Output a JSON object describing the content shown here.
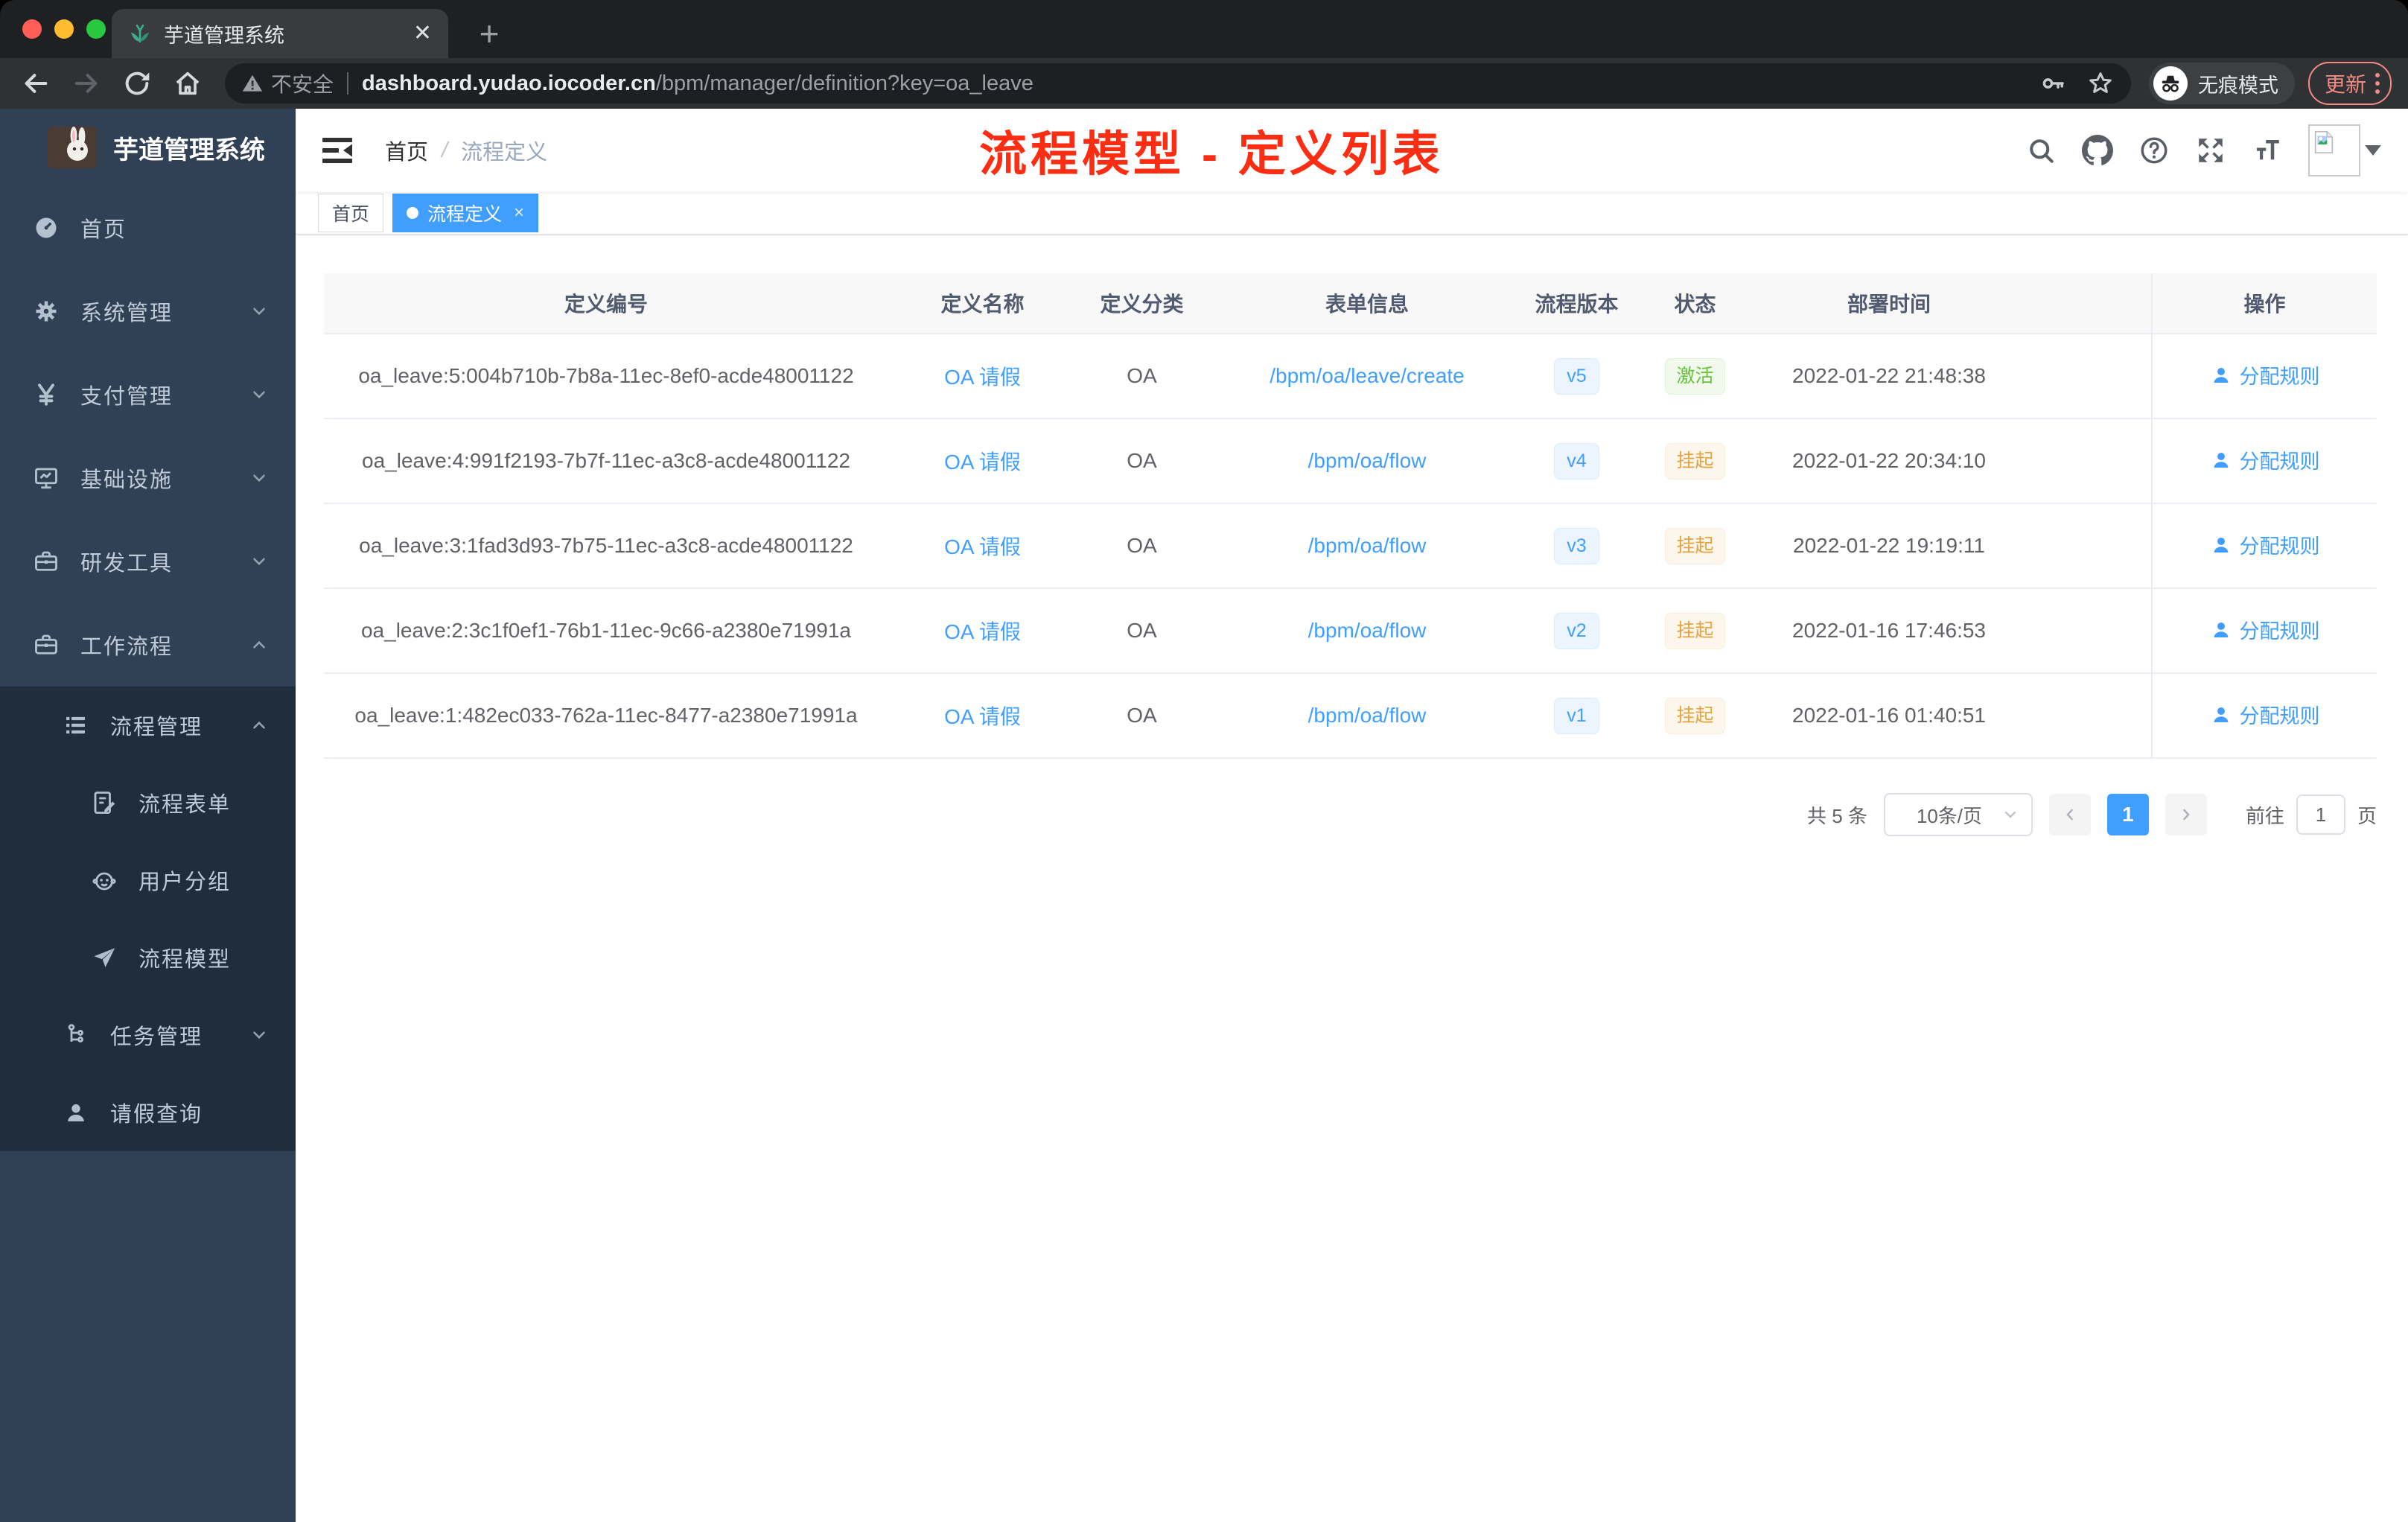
{
  "browser": {
    "tab_title": "芋道管理系统",
    "close_tab": "✕",
    "new_tab": "+",
    "security_label": "不安全",
    "url_host": "dashboard.yudao.iocoder.cn",
    "url_path": "/bpm/manager/definition?key=oa_leave",
    "incognito_label": "无痕模式",
    "update_label": "更新"
  },
  "sidebar": {
    "logo_title": "芋道管理系统",
    "items": [
      {
        "label": "首页"
      },
      {
        "label": "系统管理"
      },
      {
        "label": "支付管理"
      },
      {
        "label": "基础设施"
      },
      {
        "label": "研发工具"
      },
      {
        "label": "工作流程"
      },
      {
        "label": "流程管理"
      },
      {
        "label": "流程表单"
      },
      {
        "label": "用户分组"
      },
      {
        "label": "流程模型"
      },
      {
        "label": "任务管理"
      },
      {
        "label": "请假查询"
      }
    ]
  },
  "navbar": {
    "breadcrumb_home": "首页",
    "breadcrumb_sep": "/",
    "breadcrumb_current": "流程定义"
  },
  "overlay": {
    "title": "流程模型 - 定义列表",
    "color": "#fb2d12"
  },
  "tags": {
    "home": "首页",
    "active": "流程定义",
    "close": "×"
  },
  "table": {
    "columns": [
      "定义编号",
      "定义名称",
      "定义分类",
      "表单信息",
      "流程版本",
      "状态",
      "部署时间",
      "操作"
    ],
    "rows": [
      {
        "id": "oa_leave:5:004b710b-7b8a-11ec-8ef0-acde48001122",
        "name": "OA 请假",
        "category": "OA",
        "form": "/bpm/oa/leave/create",
        "version": "v5",
        "status": "激活",
        "time": "2022-01-22 21:48:38",
        "action": "分配规则"
      },
      {
        "id": "oa_leave:4:991f2193-7b7f-11ec-a3c8-acde48001122",
        "name": "OA 请假",
        "category": "OA",
        "form": "/bpm/oa/flow",
        "version": "v4",
        "status": "挂起",
        "time": "2022-01-22 20:34:10",
        "action": "分配规则"
      },
      {
        "id": "oa_leave:3:1fad3d93-7b75-11ec-a3c8-acde48001122",
        "name": "OA 请假",
        "category": "OA",
        "form": "/bpm/oa/flow",
        "version": "v3",
        "status": "挂起",
        "time": "2022-01-22 19:19:11",
        "action": "分配规则"
      },
      {
        "id": "oa_leave:2:3c1f0ef1-76b1-11ec-9c66-a2380e71991a",
        "name": "OA 请假",
        "category": "OA",
        "form": "/bpm/oa/flow",
        "version": "v2",
        "status": "挂起",
        "time": "2022-01-16 17:46:53",
        "action": "分配规则"
      },
      {
        "id": "oa_leave:1:482ec033-762a-11ec-8477-a2380e71991a",
        "name": "OA 请假",
        "category": "OA",
        "form": "/bpm/oa/flow",
        "version": "v1",
        "status": "挂起",
        "time": "2022-01-16 01:40:51",
        "action": "分配规则"
      }
    ]
  },
  "pagination": {
    "total": "共 5 条",
    "page_size": "10条/页",
    "current_page": "1",
    "goto_label": "前往",
    "goto_value": "1",
    "unit_label": "页"
  },
  "colors": {
    "accent": "#409eff",
    "success": "#67c23a",
    "warning": "#e6a23c",
    "sidebar_bg": "#304156",
    "submenu_bg": "#1f2d3d",
    "update_red": "#f28b82",
    "overlay_red": "#fb2d12"
  }
}
